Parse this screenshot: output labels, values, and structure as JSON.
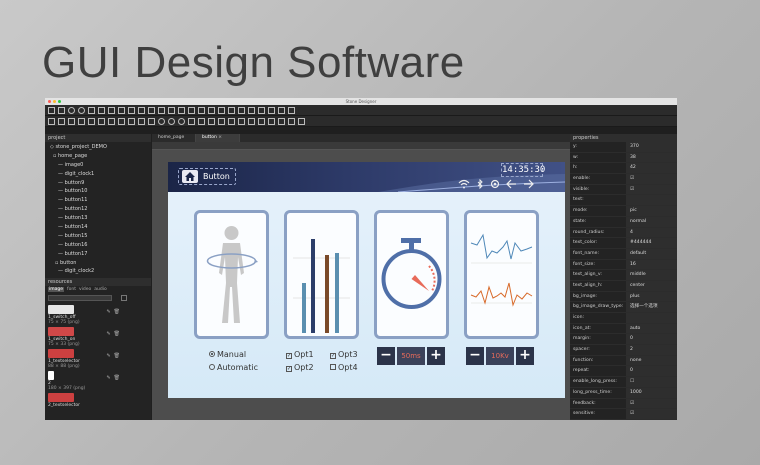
{
  "slide": {
    "title": "GUI Design Software"
  },
  "window": {
    "title": "Stone Designer"
  },
  "project_panel": {
    "heading": "project",
    "tree": [
      "stone_project_DEMO",
      "home_page",
      "image0",
      "digit_clock1",
      "button9",
      "button10",
      "button11",
      "button12",
      "button13",
      "button14",
      "button15",
      "button16",
      "button17",
      "button",
      "digit_clock2"
    ]
  },
  "resources": {
    "heading": "resources",
    "tabs": [
      "image",
      "font",
      "video",
      "audio"
    ],
    "items": [
      {
        "name": "1_switch_off",
        "meta": "75 × 75 (png)",
        "color": "#e6e6e6"
      },
      {
        "name": "1_switch_on",
        "meta": "75 × 33 (png)",
        "color": "#d04848"
      },
      {
        "name": "1_textselector",
        "meta": "88 × 88 (png)",
        "color": "#cc4040"
      },
      {
        "name": "2",
        "meta": "180 × 397 (png)",
        "color": "#ffffff"
      },
      {
        "name": "2_textselector",
        "meta": "",
        "color": "#cc4040"
      }
    ]
  },
  "tabs": [
    "home_page",
    "button"
  ],
  "screen": {
    "header_button_label": "Button",
    "clock_text": "14:35:30",
    "radio_options": [
      "Manual",
      "Automatic"
    ],
    "checkbox_options": [
      "Opt1",
      "Opt3",
      "Opt2",
      "Opt4"
    ],
    "time_value": "50ms",
    "voltage_value": "10Kv"
  },
  "properties": {
    "heading": "properties",
    "rows": [
      {
        "key": "y:",
        "value": "370"
      },
      {
        "key": "w:",
        "value": "38"
      },
      {
        "key": "h:",
        "value": "42"
      },
      {
        "key": "enable:",
        "value": "☑"
      },
      {
        "key": "visible:",
        "value": "☑"
      },
      {
        "key": "text:",
        "value": ""
      },
      {
        "key": "mode:",
        "value": "pic"
      },
      {
        "key": "state:",
        "value": "normal"
      },
      {
        "key": "round_radius:",
        "value": "4"
      },
      {
        "key": "text_color:",
        "value": "#444444"
      },
      {
        "key": "font_name:",
        "value": "default"
      },
      {
        "key": "font_size:",
        "value": "16"
      },
      {
        "key": "text_align_v:",
        "value": "middle"
      },
      {
        "key": "text_align_h:",
        "value": "center"
      },
      {
        "key": "bg_image:",
        "value": "plus"
      },
      {
        "key": "bg_image_draw_type:",
        "value": "选择一个选项"
      },
      {
        "key": "icon:",
        "value": ""
      },
      {
        "key": "icon_at:",
        "value": "auto"
      },
      {
        "key": "margin:",
        "value": "0"
      },
      {
        "key": "spacer:",
        "value": "2"
      },
      {
        "key": "function:",
        "value": "none"
      },
      {
        "key": "repeat:",
        "value": "0"
      },
      {
        "key": "enable_long_press:",
        "value": "☐"
      },
      {
        "key": "long_press_time:",
        "value": "1000"
      },
      {
        "key": "feedback:",
        "value": "☑"
      },
      {
        "key": "sensitive:",
        "value": "☑"
      }
    ]
  },
  "colors": {
    "bar_blue": "#5a8fb0",
    "bar_brown": "#7a4a2a",
    "bar_navy": "#2c3e6a",
    "accent_red": "#e86b5a",
    "wave_blue": "#4f88b8",
    "wave_orange": "#d86a2a"
  }
}
